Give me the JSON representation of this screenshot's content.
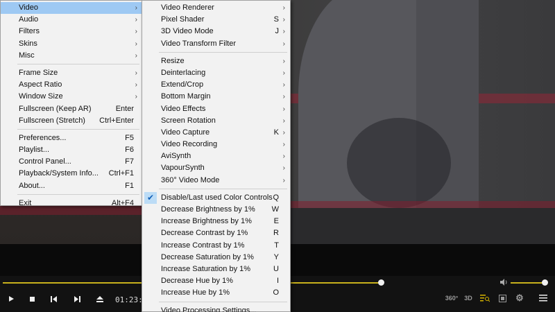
{
  "player": {
    "time": "01:23:13",
    "seek_progress": 0.685,
    "volume_level": 1.0,
    "colors": {
      "seek_accent": "#c9b21c",
      "menu_highlight": "#9ec9f3"
    }
  },
  "controls": {
    "play_icon": "play-icon",
    "stop_icon": "stop-icon",
    "prev_icon": "skip-previous-icon",
    "next_icon": "skip-next-icon",
    "eject_icon": "eject-icon",
    "right_labels": {
      "r360": "360°",
      "r3d": "3D"
    }
  },
  "main_menu": {
    "items": [
      {
        "label": "Video",
        "submenu": true
      },
      {
        "label": "Audio",
        "submenu": true
      },
      {
        "label": "Filters",
        "submenu": true
      },
      {
        "label": "Skins",
        "submenu": true
      },
      {
        "label": "Misc",
        "submenu": true
      },
      {
        "label": "Frame Size",
        "submenu": true
      },
      {
        "label": "Aspect Ratio",
        "submenu": true
      },
      {
        "label": "Window Size",
        "submenu": true
      },
      {
        "label": "Fullscreen (Keep AR)",
        "shortcut": "Enter"
      },
      {
        "label": "Fullscreen (Stretch)",
        "shortcut": "Ctrl+Enter"
      },
      {
        "label": "Preferences...",
        "shortcut": "F5"
      },
      {
        "label": "Playlist...",
        "shortcut": "F6"
      },
      {
        "label": "Control Panel...",
        "shortcut": "F7"
      },
      {
        "label": "Playback/System Info...",
        "shortcut": "Ctrl+F1"
      },
      {
        "label": "About...",
        "shortcut": "F1"
      },
      {
        "label": "Exit",
        "shortcut": "Alt+F4"
      }
    ]
  },
  "video_menu": {
    "items": [
      {
        "label": "Video Renderer",
        "submenu": true
      },
      {
        "label": "Pixel Shader",
        "shortcut": "S"
      },
      {
        "label": "3D Video Mode",
        "shortcut": "J"
      },
      {
        "label": "Video Transform Filter",
        "submenu": true
      },
      {
        "label": "Resize",
        "submenu": true
      },
      {
        "label": "Deinterlacing",
        "submenu": true
      },
      {
        "label": "Extend/Crop",
        "submenu": true
      },
      {
        "label": "Bottom Margin",
        "submenu": true
      },
      {
        "label": "Video Effects",
        "submenu": true
      },
      {
        "label": "Screen Rotation",
        "submenu": true
      },
      {
        "label": "Video Capture",
        "shortcut": "K"
      },
      {
        "label": "Video Recording",
        "submenu": true
      },
      {
        "label": "AviSynth",
        "submenu": true
      },
      {
        "label": "VapourSynth",
        "submenu": true
      },
      {
        "label": "360° Video Mode",
        "submenu": true
      },
      {
        "label": "Disable/Last used Color Controls",
        "shortcut": "Q",
        "checked": true
      },
      {
        "label": "Decrease Brightness by 1%",
        "shortcut": "W"
      },
      {
        "label": "Increase Brightness by 1%",
        "shortcut": "E"
      },
      {
        "label": "Decrease Contrast by 1%",
        "shortcut": "R"
      },
      {
        "label": "Increase Contrast by 1%",
        "shortcut": "T"
      },
      {
        "label": "Decrease Saturation by 1%",
        "shortcut": "Y"
      },
      {
        "label": "Increase Saturation by 1%",
        "shortcut": "U"
      },
      {
        "label": "Decrease Hue by 1%",
        "shortcut": "I"
      },
      {
        "label": "Increase Hue by 1%",
        "shortcut": "O"
      },
      {
        "label": "Video Processing Settings..."
      }
    ]
  }
}
